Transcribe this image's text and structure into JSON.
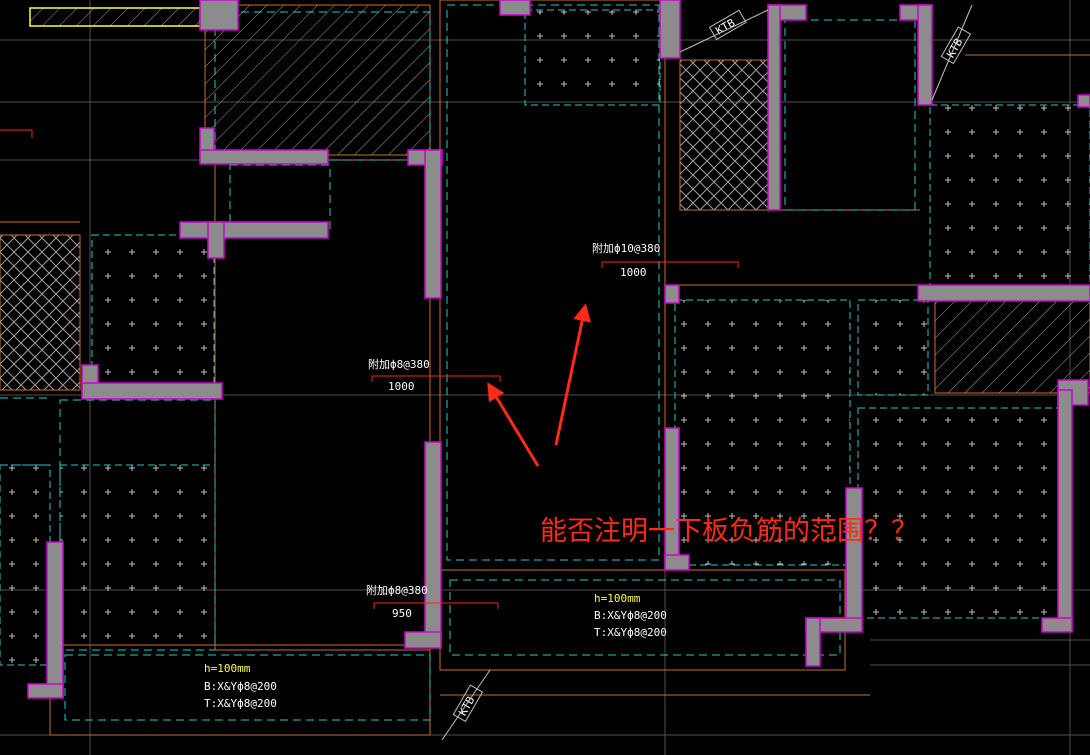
{
  "colors": {
    "background": "#000000",
    "wall_fill": "#8c8c8c",
    "wall_edge": "#d000d0",
    "boundary": "#c87028",
    "dashed": "#28c8c8",
    "grid": "#606060",
    "hatch": "#a0a0a0",
    "rebar": "#ff2020",
    "text": "#ffffff",
    "text_yellow": "#ffff40",
    "annotation": "#ff2a18"
  },
  "rebar_labels": [
    {
      "spec": "附加ф10@380",
      "length": "1000"
    },
    {
      "spec": "附加ф8@380",
      "length": "1000"
    },
    {
      "spec": "附加ф8@380",
      "length": "950"
    }
  ],
  "slab_notes": [
    {
      "h": "h=100mm",
      "bottom": "B:X&Yф8@200",
      "top": "T:X&Yф8@200"
    },
    {
      "h": "h=100mm",
      "bottom": "B:X&Yф8@200",
      "top": "T:X&Yф8@200"
    }
  ],
  "ktb_labels": [
    "KTB",
    "KTB",
    "KTB"
  ],
  "annotation": {
    "question": "能否注明一下板负筋的范围？？"
  }
}
